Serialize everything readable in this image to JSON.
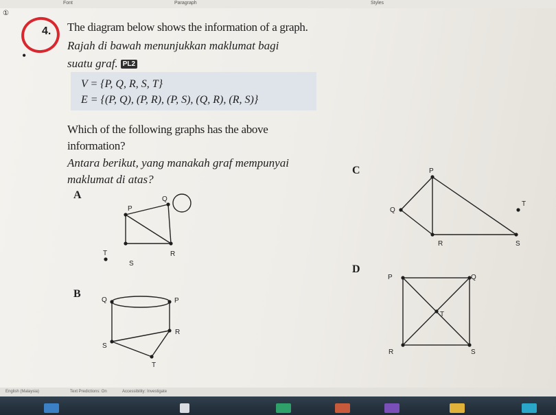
{
  "ribbon": {
    "font": "Font",
    "paragraph": "Paragraph",
    "styles": "Styles"
  },
  "question": {
    "number": "4.",
    "en": "The diagram below shows the information of a graph.",
    "ms_line1": "Rajah di bawah menunjukkan maklumat bagi",
    "ms_line2": "suatu graf.",
    "badge": "PL2",
    "v_set": "V = {P, Q, R, S, T}",
    "e_set": "E = {(P, Q), (P, R), (P, S), (Q, R), (R, S)}",
    "prompt_en_1": "Which of the following graphs has the above",
    "prompt_en_2": "information?",
    "prompt_ms_1": "Antara berikut, yang manakah graf mempunyai",
    "prompt_ms_2": "maklumat di atas?"
  },
  "options": {
    "a": "A",
    "b": "B",
    "c": "C",
    "d": "D"
  },
  "graph_a": {
    "p": "P",
    "q": "Q",
    "r": "R",
    "s": "S",
    "t": "T"
  },
  "graph_b": {
    "p": "P",
    "q": "Q",
    "r": "R",
    "s": "S",
    "t": "T"
  },
  "graph_c": {
    "p": "P",
    "q": "Q",
    "r": "R",
    "s": "S",
    "t": "T"
  },
  "graph_d": {
    "p": "P",
    "q": "Q",
    "r": "R",
    "s": "S",
    "t": "T"
  },
  "status": {
    "language": "English (Malaysia)",
    "predictions": "Text Predictions: On",
    "accessibility": "Accessibility: Investigate"
  },
  "colors": {
    "annotation": "#d8282f",
    "set_highlight": "#dfe3ea",
    "taskbar": "#26333e"
  }
}
